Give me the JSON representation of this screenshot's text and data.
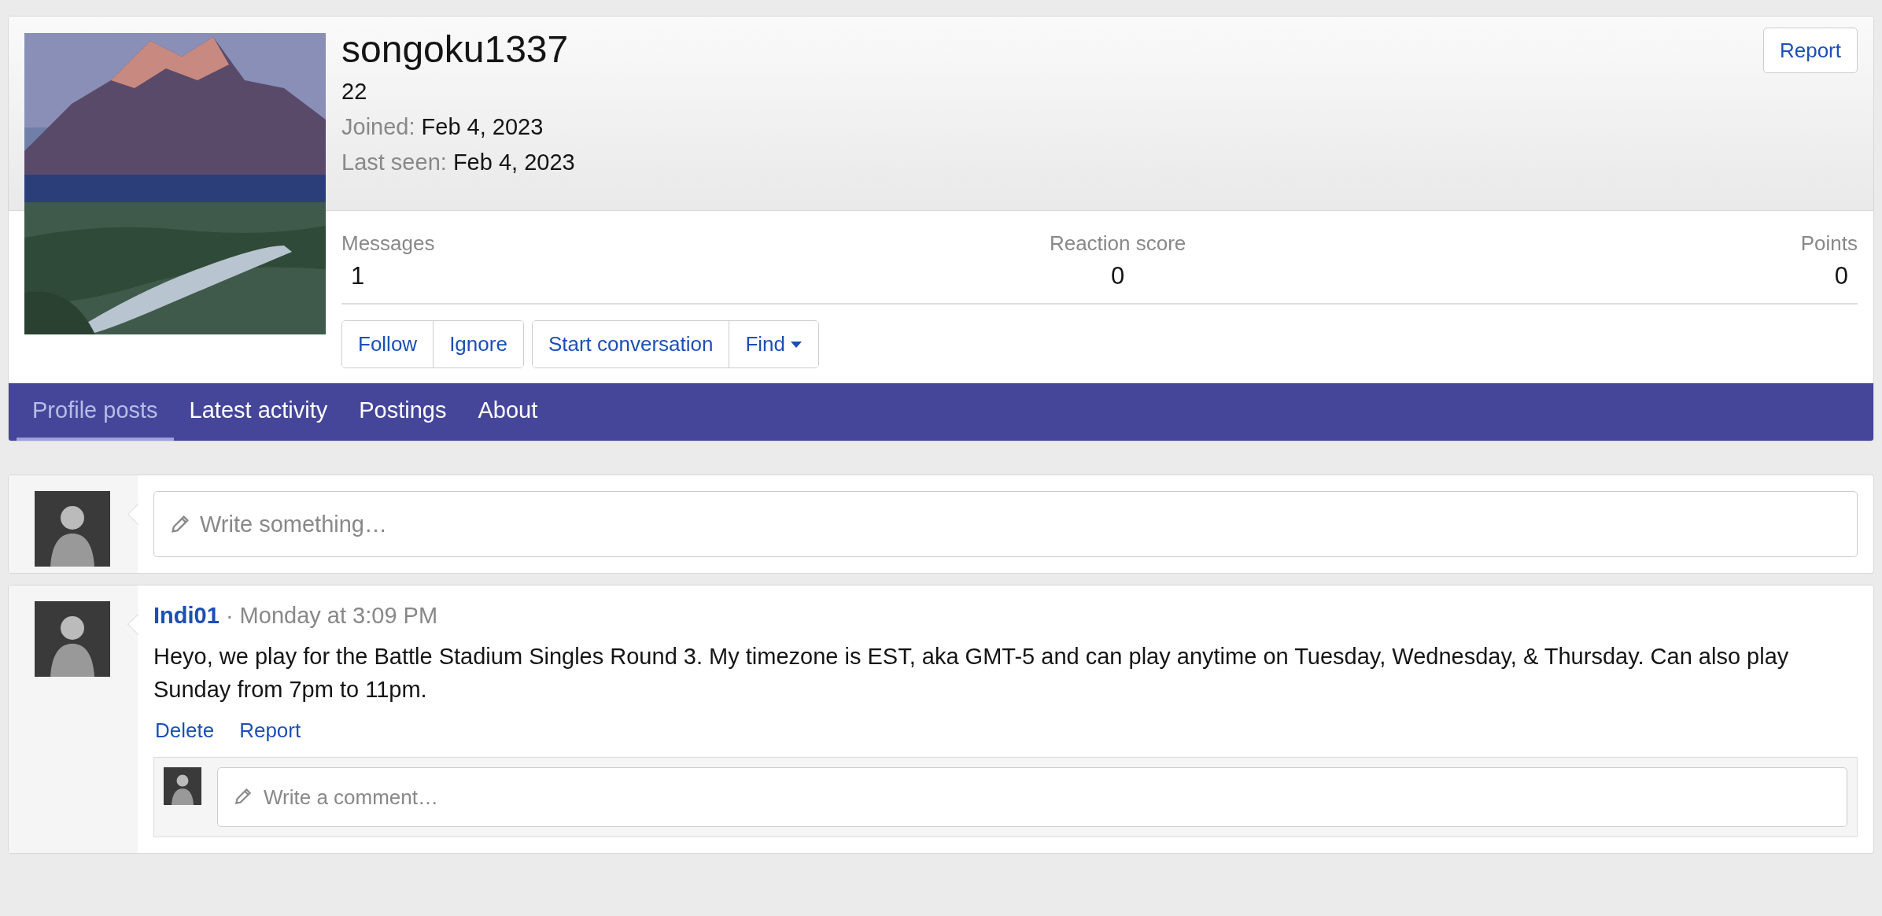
{
  "profile": {
    "username": "songoku1337",
    "age": "22",
    "details": [
      {
        "label": "Joined:",
        "value": "Feb 4, 2023"
      },
      {
        "label": "Last seen:",
        "value": "Feb 4, 2023"
      }
    ],
    "report_button": "Report",
    "stats": [
      {
        "label": "Messages",
        "value": "1"
      },
      {
        "label": "Reaction score",
        "value": "0"
      },
      {
        "label": "Points",
        "value": "0"
      }
    ],
    "button_groups": [
      [
        {
          "label": "Follow",
          "kind": "plain"
        },
        {
          "label": "Ignore",
          "kind": "plain"
        }
      ],
      [
        {
          "label": "Start conversation",
          "kind": "plain"
        },
        {
          "label": "Find",
          "kind": "dropdown"
        }
      ]
    ]
  },
  "tabs": [
    {
      "label": "Profile posts",
      "selected": true
    },
    {
      "label": "Latest activity",
      "selected": false
    },
    {
      "label": "Postings",
      "selected": false
    },
    {
      "label": "About",
      "selected": false
    }
  ],
  "composer": {
    "placeholder": "Write something…"
  },
  "post": {
    "author": "Indi01",
    "separator": "·",
    "time": "Monday at 3:09 PM",
    "body": "Heyo, we play for the Battle Stadium Singles Round 3. My timezone is EST, aka GMT-5 and can play anytime on Tuesday, Wednesday, & Thursday. Can also play Sunday from 7pm to 11pm.",
    "actions": [
      "Delete",
      "Report"
    ],
    "comment": {
      "placeholder": "Write a comment…"
    }
  }
}
